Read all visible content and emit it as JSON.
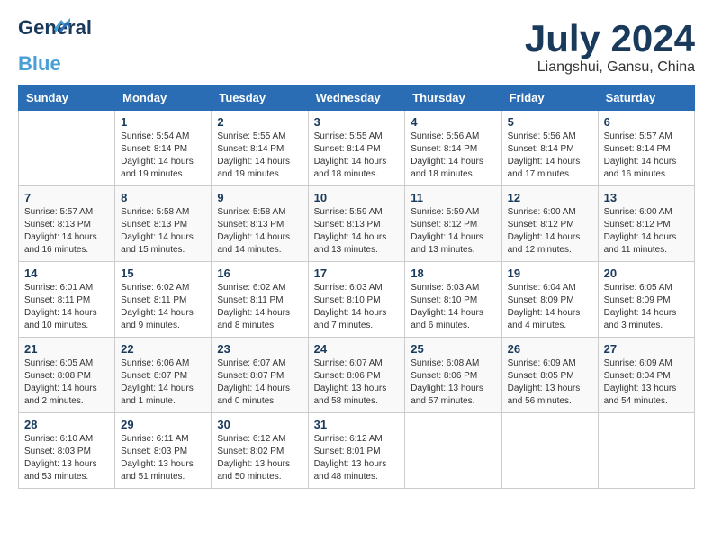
{
  "header": {
    "logo_line1": "General",
    "logo_line2": "Blue",
    "month": "July 2024",
    "location": "Liangshui, Gansu, China"
  },
  "weekdays": [
    "Sunday",
    "Monday",
    "Tuesday",
    "Wednesday",
    "Thursday",
    "Friday",
    "Saturday"
  ],
  "weeks": [
    [
      {
        "day": "",
        "info": ""
      },
      {
        "day": "1",
        "info": "Sunrise: 5:54 AM\nSunset: 8:14 PM\nDaylight: 14 hours\nand 19 minutes."
      },
      {
        "day": "2",
        "info": "Sunrise: 5:55 AM\nSunset: 8:14 PM\nDaylight: 14 hours\nand 19 minutes."
      },
      {
        "day": "3",
        "info": "Sunrise: 5:55 AM\nSunset: 8:14 PM\nDaylight: 14 hours\nand 18 minutes."
      },
      {
        "day": "4",
        "info": "Sunrise: 5:56 AM\nSunset: 8:14 PM\nDaylight: 14 hours\nand 18 minutes."
      },
      {
        "day": "5",
        "info": "Sunrise: 5:56 AM\nSunset: 8:14 PM\nDaylight: 14 hours\nand 17 minutes."
      },
      {
        "day": "6",
        "info": "Sunrise: 5:57 AM\nSunset: 8:14 PM\nDaylight: 14 hours\nand 16 minutes."
      }
    ],
    [
      {
        "day": "7",
        "info": "Sunrise: 5:57 AM\nSunset: 8:13 PM\nDaylight: 14 hours\nand 16 minutes."
      },
      {
        "day": "8",
        "info": "Sunrise: 5:58 AM\nSunset: 8:13 PM\nDaylight: 14 hours\nand 15 minutes."
      },
      {
        "day": "9",
        "info": "Sunrise: 5:58 AM\nSunset: 8:13 PM\nDaylight: 14 hours\nand 14 minutes."
      },
      {
        "day": "10",
        "info": "Sunrise: 5:59 AM\nSunset: 8:13 PM\nDaylight: 14 hours\nand 13 minutes."
      },
      {
        "day": "11",
        "info": "Sunrise: 5:59 AM\nSunset: 8:12 PM\nDaylight: 14 hours\nand 13 minutes."
      },
      {
        "day": "12",
        "info": "Sunrise: 6:00 AM\nSunset: 8:12 PM\nDaylight: 14 hours\nand 12 minutes."
      },
      {
        "day": "13",
        "info": "Sunrise: 6:00 AM\nSunset: 8:12 PM\nDaylight: 14 hours\nand 11 minutes."
      }
    ],
    [
      {
        "day": "14",
        "info": "Sunrise: 6:01 AM\nSunset: 8:11 PM\nDaylight: 14 hours\nand 10 minutes."
      },
      {
        "day": "15",
        "info": "Sunrise: 6:02 AM\nSunset: 8:11 PM\nDaylight: 14 hours\nand 9 minutes."
      },
      {
        "day": "16",
        "info": "Sunrise: 6:02 AM\nSunset: 8:11 PM\nDaylight: 14 hours\nand 8 minutes."
      },
      {
        "day": "17",
        "info": "Sunrise: 6:03 AM\nSunset: 8:10 PM\nDaylight: 14 hours\nand 7 minutes."
      },
      {
        "day": "18",
        "info": "Sunrise: 6:03 AM\nSunset: 8:10 PM\nDaylight: 14 hours\nand 6 minutes."
      },
      {
        "day": "19",
        "info": "Sunrise: 6:04 AM\nSunset: 8:09 PM\nDaylight: 14 hours\nand 4 minutes."
      },
      {
        "day": "20",
        "info": "Sunrise: 6:05 AM\nSunset: 8:09 PM\nDaylight: 14 hours\nand 3 minutes."
      }
    ],
    [
      {
        "day": "21",
        "info": "Sunrise: 6:05 AM\nSunset: 8:08 PM\nDaylight: 14 hours\nand 2 minutes."
      },
      {
        "day": "22",
        "info": "Sunrise: 6:06 AM\nSunset: 8:07 PM\nDaylight: 14 hours\nand 1 minute."
      },
      {
        "day": "23",
        "info": "Sunrise: 6:07 AM\nSunset: 8:07 PM\nDaylight: 14 hours\nand 0 minutes."
      },
      {
        "day": "24",
        "info": "Sunrise: 6:07 AM\nSunset: 8:06 PM\nDaylight: 13 hours\nand 58 minutes."
      },
      {
        "day": "25",
        "info": "Sunrise: 6:08 AM\nSunset: 8:06 PM\nDaylight: 13 hours\nand 57 minutes."
      },
      {
        "day": "26",
        "info": "Sunrise: 6:09 AM\nSunset: 8:05 PM\nDaylight: 13 hours\nand 56 minutes."
      },
      {
        "day": "27",
        "info": "Sunrise: 6:09 AM\nSunset: 8:04 PM\nDaylight: 13 hours\nand 54 minutes."
      }
    ],
    [
      {
        "day": "28",
        "info": "Sunrise: 6:10 AM\nSunset: 8:03 PM\nDaylight: 13 hours\nand 53 minutes."
      },
      {
        "day": "29",
        "info": "Sunrise: 6:11 AM\nSunset: 8:03 PM\nDaylight: 13 hours\nand 51 minutes."
      },
      {
        "day": "30",
        "info": "Sunrise: 6:12 AM\nSunset: 8:02 PM\nDaylight: 13 hours\nand 50 minutes."
      },
      {
        "day": "31",
        "info": "Sunrise: 6:12 AM\nSunset: 8:01 PM\nDaylight: 13 hours\nand 48 minutes."
      },
      {
        "day": "",
        "info": ""
      },
      {
        "day": "",
        "info": ""
      },
      {
        "day": "",
        "info": ""
      }
    ]
  ]
}
